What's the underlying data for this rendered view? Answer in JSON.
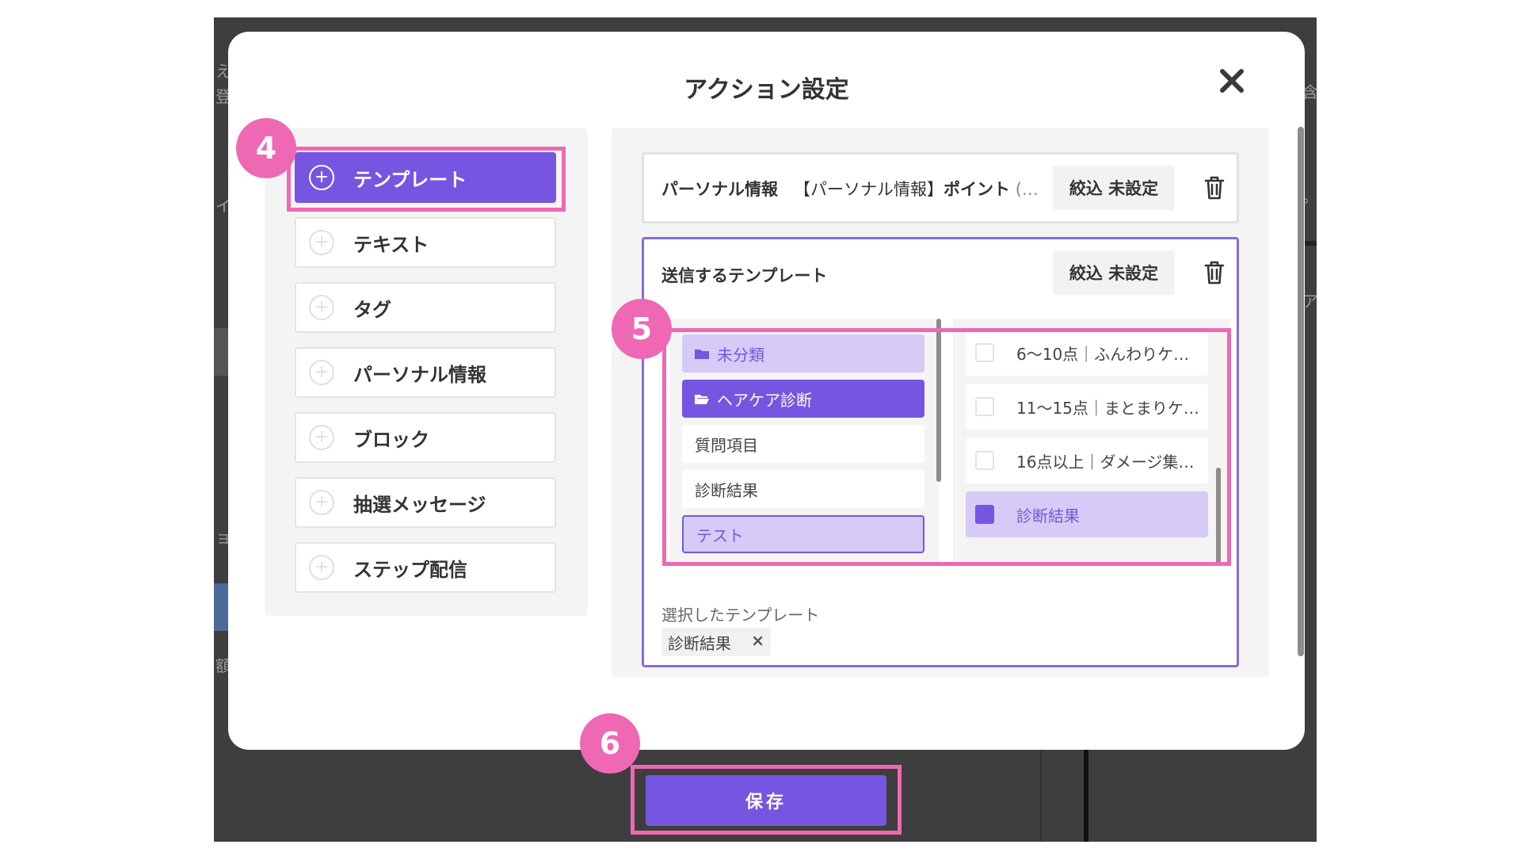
{
  "modal": {
    "title": "アクション設定",
    "close_icon": "close-icon"
  },
  "menu": {
    "items": [
      {
        "label": "テンプレート",
        "active": true
      },
      {
        "label": "テキスト"
      },
      {
        "label": "タグ"
      },
      {
        "label": "パーソナル情報"
      },
      {
        "label": "ブロック"
      },
      {
        "label": "抽選メッセージ"
      },
      {
        "label": "ステップ配信"
      }
    ]
  },
  "personal_card": {
    "type_label": "パーソナル情報",
    "field_label": "【パーソナル情報】",
    "value_label": "ポイント",
    "overflow": "(…",
    "filter_label": "絞込 未設定"
  },
  "template_card": {
    "title": "送信するテンプレート",
    "filter_label": "絞込 未設定",
    "folders": [
      {
        "label": "未分類",
        "icon": "folder-icon"
      },
      {
        "label": "ヘアケア診断",
        "icon": "folder-open-icon"
      },
      {
        "label": "質問項目"
      },
      {
        "label": "診断結果"
      },
      {
        "label": "テスト"
      }
    ],
    "templates": [
      {
        "label": "6〜10点｜ふんわりケ…"
      },
      {
        "label": "11〜15点｜まとまりケ…"
      },
      {
        "label": "16点以上｜ダメージ集…"
      },
      {
        "label": "診断結果",
        "checked": true
      }
    ],
    "selected_label": "選択したテンプレート",
    "selected_chip": "診断結果",
    "chip_close": "×"
  },
  "save_label": "保存",
  "steps": [
    "4",
    "5",
    "6"
  ],
  "background": {
    "snippets": [
      "え",
      "登",
      "イ",
      "ョ",
      "額",
      "ア",
      "。",
      "含"
    ]
  },
  "colors": {
    "accent": "#7656e0",
    "accent_light": "#d5cbf6",
    "highlight": "#ef68b4"
  }
}
